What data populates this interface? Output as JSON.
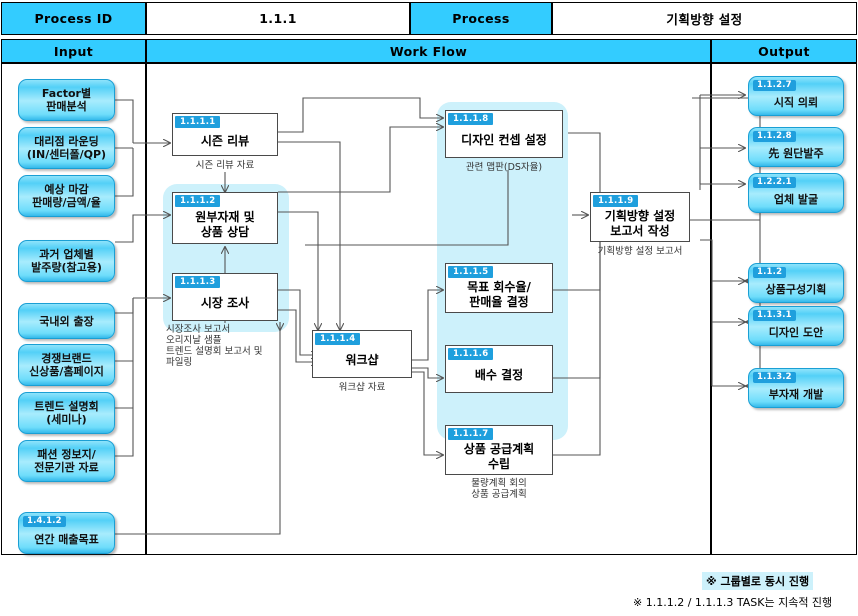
{
  "header": {
    "process_id_label": "Process ID",
    "process_id_value": "1.1.1",
    "process_label": "Process",
    "process_value": "기획방향 설정",
    "col_input": "Input",
    "col_workflow": "Work  Flow",
    "col_output": "Output"
  },
  "inputs": [
    {
      "tag": "",
      "label": "Factor별\n판매분석"
    },
    {
      "tag": "",
      "label": "대리점 라운딩\n(IN/센터폴/QP)"
    },
    {
      "tag": "",
      "label": "예상 마감\n판매량/금액/율"
    },
    {
      "tag": "",
      "label": "과거 업체별\n발주량(참고용)"
    },
    {
      "tag": "",
      "label": "국내외 출장"
    },
    {
      "tag": "",
      "label": "경쟁브랜드\n신상품/홈페이지"
    },
    {
      "tag": "",
      "label": "트렌드 설명회\n(세미나)"
    },
    {
      "tag": "",
      "label": "패션 정보지/\n전문기관 자료"
    },
    {
      "tag": "1.4.1.2",
      "label": "연간 매출목표"
    }
  ],
  "workflow": [
    {
      "tag": "1.1.1.1",
      "label": "시즌 리뷰",
      "caption": "시즌 리뷰 자료"
    },
    {
      "tag": "1.1.1.2",
      "label": "원부자재 및\n상품 상담",
      "caption": ""
    },
    {
      "tag": "1.1.1.3",
      "label": "시장 조사",
      "caption": "시장조사 보고서\n오리지날 샘플\n트렌드 설명회 보고서 및\n파일링"
    },
    {
      "tag": "1.1.1.4",
      "label": "워크샵",
      "caption": "워크샵 자료"
    },
    {
      "tag": "1.1.1.8",
      "label": "디자인 컨셉 설정",
      "caption": "관련 맵판(DS자율)"
    },
    {
      "tag": "1.1.1.5",
      "label": "목표 회수율/\n판매율 결정",
      "caption": ""
    },
    {
      "tag": "1.1.1.6",
      "label": "배수 결정",
      "caption": ""
    },
    {
      "tag": "1.1.1.7",
      "label": "상품 공급계획\n수립",
      "caption": "물량계획 회의\n상품 공급계획"
    },
    {
      "tag": "1.1.1.9",
      "label": "기획방향 설정\n보고서 작성",
      "caption": "기획방향 설정 보고서"
    }
  ],
  "outputs": [
    {
      "tag": "1.1.2.7",
      "label": "시직 의뢰"
    },
    {
      "tag": "1.1.2.8",
      "label": "先 원단발주"
    },
    {
      "tag": "1.2.2.1",
      "label": "업체 발굴"
    },
    {
      "tag": "1.1.2",
      "label": "상품구성기획"
    },
    {
      "tag": "1.1.3.1",
      "label": "디자인 도안"
    },
    {
      "tag": "1.1.3.2",
      "label": "부자재 개발"
    }
  ],
  "footer": {
    "note_highlight": "※ 그룹별로 동시 진행",
    "note_plain": "※ 1.1.1.2 / 1.1.1.3 TASK는 지속적 진행"
  },
  "colors": {
    "header_cyan": "#33ccff",
    "tag_blue": "#1f9fdd",
    "highlight": "#cdf1fb",
    "wire": "#555555",
    "box_border": "#4a4a4a"
  }
}
